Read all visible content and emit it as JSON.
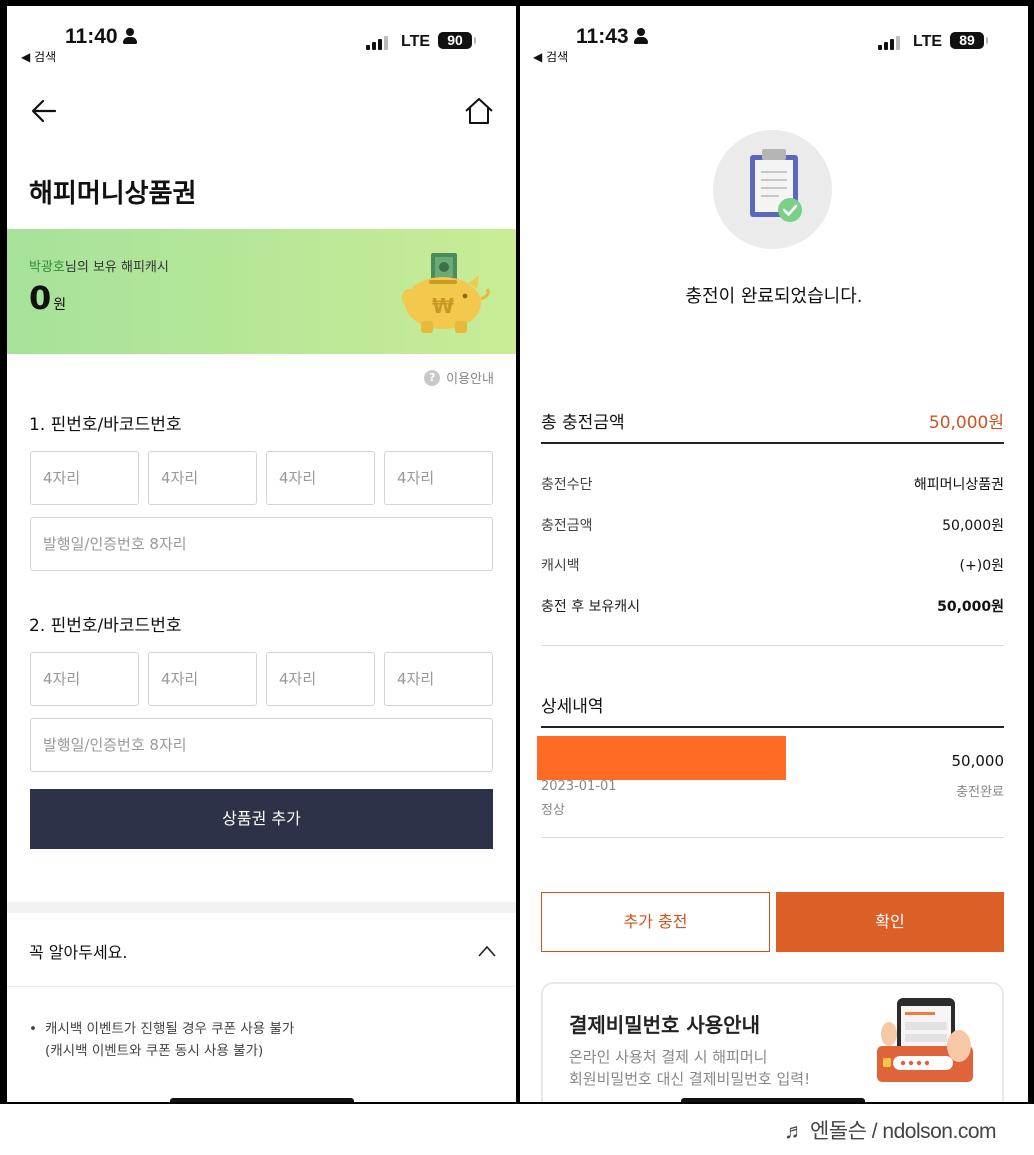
{
  "left": {
    "status": {
      "time": "11:40",
      "back_label": "◀ 검색",
      "network": "LTE",
      "battery": "90"
    },
    "title": "해피머니상품권",
    "cash": {
      "owner_name": "박광호",
      "owner_suffix": "님의 보유 해피캐시",
      "amount": "0",
      "unit": "원"
    },
    "help_label": "이용안내",
    "help_icon": "?",
    "group1": {
      "label": "1. 핀번호/바코드번호",
      "pin_placeholders": [
        "4자리",
        "4자리",
        "4자리",
        "4자리"
      ],
      "date_placeholder": "발행일/인증번호 8자리"
    },
    "group2": {
      "label": "2. 핀번호/바코드번호",
      "pin_placeholders": [
        "4자리",
        "4자리",
        "4자리",
        "4자리"
      ],
      "date_placeholder": "발행일/인증번호 8자리"
    },
    "add_button": "상품권 추가",
    "notice": {
      "title": "꼭 알아두세요.",
      "bullet": "•",
      "line1": "캐시백 이벤트가 진행될 경우 쿠폰 사용 불가",
      "line2": "(캐시백 이벤트와 쿠폰 동시 사용 불가)"
    }
  },
  "right": {
    "status": {
      "time": "11:43",
      "back_label": "◀ 검색",
      "network": "LTE",
      "battery": "89"
    },
    "complete_message": "충전이 완료되었습니다.",
    "total": {
      "label": "총 충전금액",
      "value": "50,000원"
    },
    "details": [
      {
        "label": "충전수단",
        "value": "해피머니상품권"
      },
      {
        "label": "충전금액",
        "value": "50,000원"
      },
      {
        "label": "캐시백",
        "value": "(+)0원"
      },
      {
        "label": "충전 후 보유캐시",
        "value": "50,000원"
      }
    ],
    "history": {
      "title": "상세내역",
      "amount": "50,000",
      "date": "2023-01-01",
      "state": "정상",
      "status": "충전완료"
    },
    "buttons": {
      "more": "추가 충전",
      "confirm": "확인"
    },
    "info_card": {
      "title": "결제비밀번호 사용안내",
      "line1": "온라인 사용처 결제 시 해피머니",
      "line2": "회원비밀번호 대신 결제비밀번호 입력!"
    }
  },
  "watermark": "♬ 엔돌슨 / ndolson.com",
  "colors": {
    "accent_orange": "#dc5f27",
    "button_navy": "#2d3248",
    "banner_green": "#b6e697",
    "redaction": "#ff6a25"
  }
}
